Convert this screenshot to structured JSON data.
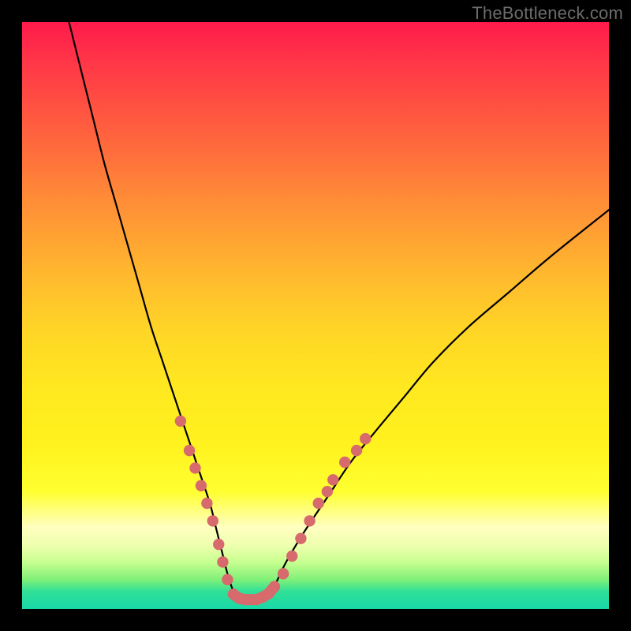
{
  "watermark": "TheBottleneck.com",
  "colors": {
    "frame": "#000000",
    "curve_stroke": "#000000",
    "marker_fill": "#d76a6c",
    "marker_stroke": "#c85a5c"
  },
  "chart_data": {
    "type": "line",
    "title": "",
    "xlabel": "",
    "ylabel": "",
    "xlim": [
      0,
      100
    ],
    "ylim": [
      0,
      100
    ],
    "grid": false,
    "series": [
      {
        "name": "bottleneck-curve",
        "x": [
          8,
          10,
          12,
          14,
          16,
          18,
          20,
          22,
          24,
          26,
          28,
          30,
          32,
          33,
          34,
          35,
          36,
          37,
          38,
          39,
          40,
          41,
          43,
          45,
          48,
          52,
          56,
          60,
          65,
          70,
          76,
          83,
          90,
          100
        ],
        "y": [
          100,
          92,
          84,
          76,
          69,
          62,
          55,
          48,
          42,
          36,
          30,
          24,
          18,
          14,
          10,
          6,
          3,
          1.5,
          1.5,
          1.5,
          1.5,
          2,
          4,
          8,
          13,
          19,
          25,
          30,
          36,
          42,
          48,
          54,
          60,
          68
        ]
      }
    ],
    "markers": [
      {
        "name": "left-cluster",
        "x": 27.0,
        "y": 32
      },
      {
        "name": "left-cluster",
        "x": 28.5,
        "y": 27
      },
      {
        "name": "left-cluster",
        "x": 29.5,
        "y": 24
      },
      {
        "name": "left-cluster",
        "x": 30.5,
        "y": 21
      },
      {
        "name": "left-cluster",
        "x": 31.5,
        "y": 18
      },
      {
        "name": "left-cluster",
        "x": 32.5,
        "y": 15
      },
      {
        "name": "left-cluster",
        "x": 33.5,
        "y": 11
      },
      {
        "name": "left-cluster",
        "x": 34.2,
        "y": 8
      },
      {
        "name": "left-cluster",
        "x": 35.0,
        "y": 5
      },
      {
        "name": "flat-bottom",
        "x": 36.0,
        "y": 2.5
      },
      {
        "name": "flat-bottom",
        "x": 37.0,
        "y": 1.8
      },
      {
        "name": "flat-bottom",
        "x": 38.0,
        "y": 1.6
      },
      {
        "name": "flat-bottom",
        "x": 39.0,
        "y": 1.6
      },
      {
        "name": "flat-bottom",
        "x": 40.0,
        "y": 1.6
      },
      {
        "name": "flat-bottom",
        "x": 41.0,
        "y": 2.0
      },
      {
        "name": "flat-bottom",
        "x": 42.0,
        "y": 2.6
      },
      {
        "name": "flat-bottom",
        "x": 43.0,
        "y": 3.8
      },
      {
        "name": "right-cluster",
        "x": 44.5,
        "y": 6
      },
      {
        "name": "right-cluster",
        "x": 46.0,
        "y": 9
      },
      {
        "name": "right-cluster",
        "x": 47.5,
        "y": 12
      },
      {
        "name": "right-cluster",
        "x": 49.0,
        "y": 15
      },
      {
        "name": "right-cluster",
        "x": 50.5,
        "y": 18
      },
      {
        "name": "right-cluster",
        "x": 52.0,
        "y": 20
      },
      {
        "name": "right-cluster",
        "x": 53.0,
        "y": 22
      },
      {
        "name": "right-cluster",
        "x": 55.0,
        "y": 25
      },
      {
        "name": "right-cluster",
        "x": 57.0,
        "y": 27
      },
      {
        "name": "right-cluster",
        "x": 58.5,
        "y": 29
      }
    ]
  }
}
